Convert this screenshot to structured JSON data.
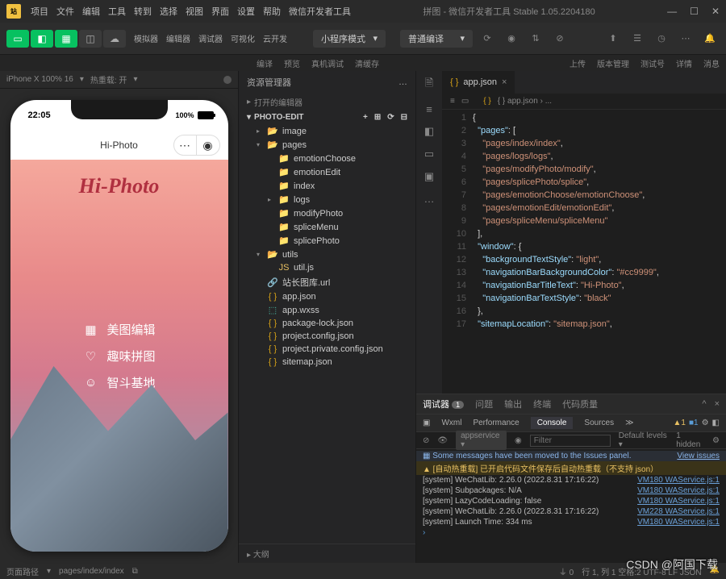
{
  "titlebar": {
    "menus": [
      "项目",
      "文件",
      "编辑",
      "工具",
      "转到",
      "选择",
      "视图",
      "界面",
      "设置",
      "帮助",
      "微信开发者工具"
    ],
    "title": "拼图 - 微信开发者工具 Stable 1.05.2204180"
  },
  "toolbar": {
    "labels1": [
      "模拟器",
      "编辑器",
      "调试器",
      "可视化",
      "云开发"
    ],
    "sel1": "小程序模式",
    "sel2": "普通编译",
    "labels2": [
      "编译",
      "预览",
      "真机调试",
      "清缓存"
    ],
    "labels3": [
      "上传",
      "版本管理",
      "测试号",
      "详情",
      "消息"
    ]
  },
  "siminfo": {
    "device": "iPhone X 100% 16",
    "hot": "热重载: 开"
  },
  "phone": {
    "time": "22:05",
    "battpct": "100%",
    "appname": "Hi-Photo",
    "hero": "Hi-Photo",
    "menu": [
      {
        "icon": "image",
        "label": "美图编辑"
      },
      {
        "icon": "heart",
        "label": "趣味拼图"
      },
      {
        "icon": "smile",
        "label": "智斗基地"
      }
    ]
  },
  "explorer": {
    "title": "资源管理器",
    "openeditors": "打开的编辑器",
    "root": "PHOTO-EDIT",
    "outline": "大纲",
    "tree": [
      {
        "d": 1,
        "t": "folder-g",
        "label": "image",
        "arrow": "▸"
      },
      {
        "d": 1,
        "t": "folder-g",
        "label": "pages",
        "arrow": "▾"
      },
      {
        "d": 2,
        "t": "folder",
        "label": "emotionChoose"
      },
      {
        "d": 2,
        "t": "folder",
        "label": "emotionEdit"
      },
      {
        "d": 2,
        "t": "folder",
        "label": "index"
      },
      {
        "d": 2,
        "t": "folder",
        "label": "logs",
        "arrow": "▸"
      },
      {
        "d": 2,
        "t": "folder",
        "label": "modifyPhoto"
      },
      {
        "d": 2,
        "t": "folder",
        "label": "spliceMenu"
      },
      {
        "d": 2,
        "t": "folder",
        "label": "splicePhoto"
      },
      {
        "d": 1,
        "t": "folder-g",
        "label": "utils",
        "arrow": "▾"
      },
      {
        "d": 2,
        "t": "jsfile",
        "label": "util.js"
      },
      {
        "d": 1,
        "t": "urlfile",
        "label": "站长图库.url"
      },
      {
        "d": 1,
        "t": "jsonfile",
        "label": "app.json"
      },
      {
        "d": 1,
        "t": "wxss",
        "label": "app.wxss"
      },
      {
        "d": 1,
        "t": "jsonfile",
        "label": "package-lock.json"
      },
      {
        "d": 1,
        "t": "jsonfile",
        "label": "project.config.json"
      },
      {
        "d": 1,
        "t": "jsonfile",
        "label": "project.private.config.json"
      },
      {
        "d": 1,
        "t": "jsonfile",
        "label": "sitemap.json"
      }
    ]
  },
  "editor": {
    "tab": "app.json",
    "crumbs": "{ } app.json › ...",
    "lines": [
      {
        "n": 1,
        "t": [
          [
            "pun",
            "{"
          ]
        ]
      },
      {
        "n": 2,
        "t": [
          [
            "pun",
            "  "
          ],
          [
            "key",
            "\"pages\""
          ],
          [
            "pun",
            ": ["
          ]
        ]
      },
      {
        "n": 3,
        "t": [
          [
            "pun",
            "    "
          ],
          [
            "str",
            "\"pages/index/index\""
          ],
          [
            "pun",
            ","
          ]
        ]
      },
      {
        "n": 4,
        "t": [
          [
            "pun",
            "    "
          ],
          [
            "str",
            "\"pages/logs/logs\""
          ],
          [
            "pun",
            ","
          ]
        ]
      },
      {
        "n": 5,
        "t": [
          [
            "pun",
            "    "
          ],
          [
            "str",
            "\"pages/modifyPhoto/modify\""
          ],
          [
            "pun",
            ","
          ]
        ]
      },
      {
        "n": 6,
        "t": [
          [
            "pun",
            "    "
          ],
          [
            "str",
            "\"pages/splicePhoto/splice\""
          ],
          [
            "pun",
            ","
          ]
        ]
      },
      {
        "n": 7,
        "t": [
          [
            "pun",
            "    "
          ],
          [
            "str",
            "\"pages/emotionChoose/emotionChoose\""
          ],
          [
            "pun",
            ","
          ]
        ]
      },
      {
        "n": 8,
        "t": [
          [
            "pun",
            "    "
          ],
          [
            "str",
            "\"pages/emotionEdit/emotionEdit\""
          ],
          [
            "pun",
            ","
          ]
        ]
      },
      {
        "n": 9,
        "t": [
          [
            "pun",
            "    "
          ],
          [
            "str",
            "\"pages/spliceMenu/spliceMenu\""
          ]
        ]
      },
      {
        "n": 10,
        "t": [
          [
            "pun",
            "  ],"
          ]
        ]
      },
      {
        "n": 11,
        "t": [
          [
            "pun",
            "  "
          ],
          [
            "key",
            "\"window\""
          ],
          [
            "pun",
            ": {"
          ]
        ]
      },
      {
        "n": 12,
        "t": [
          [
            "pun",
            "    "
          ],
          [
            "key",
            "\"backgroundTextStyle\""
          ],
          [
            "pun",
            ": "
          ],
          [
            "str",
            "\"light\""
          ],
          [
            "pun",
            ","
          ]
        ]
      },
      {
        "n": 13,
        "t": [
          [
            "pun",
            "    "
          ],
          [
            "key",
            "\"navigationBarBackgroundColor\""
          ],
          [
            "pun",
            ": "
          ],
          [
            "str",
            "\"#cc9999\""
          ],
          [
            "pun",
            ","
          ]
        ]
      },
      {
        "n": 14,
        "t": [
          [
            "pun",
            "    "
          ],
          [
            "key",
            "\"navigationBarTitleText\""
          ],
          [
            "pun",
            ": "
          ],
          [
            "str",
            "\"Hi-Photo\""
          ],
          [
            "pun",
            ","
          ]
        ]
      },
      {
        "n": 15,
        "t": [
          [
            "pun",
            "    "
          ],
          [
            "key",
            "\"navigationBarTextStyle\""
          ],
          [
            "pun",
            ": "
          ],
          [
            "str",
            "\"black\""
          ]
        ]
      },
      {
        "n": 16,
        "t": [
          [
            "pun",
            "  },"
          ]
        ]
      },
      {
        "n": 17,
        "t": [
          [
            "pun",
            "  "
          ],
          [
            "key",
            "\"sitemapLocation\""
          ],
          [
            "pun",
            ": "
          ],
          [
            "str",
            "\"sitemap.json\""
          ],
          [
            "pun",
            ","
          ]
        ]
      }
    ]
  },
  "console": {
    "tabs": [
      "调试器",
      "问题",
      "输出",
      "终端",
      "代码质量"
    ],
    "debugbadge": "1",
    "devtabs": [
      "Wxml",
      "Performance",
      "Console",
      "Sources"
    ],
    "warncount": "1",
    "infocount": "1",
    "context": "appservice",
    "filterph": "Filter",
    "levels": "Default levels",
    "hidden": "1 hidden",
    "issues": "Some messages have been moved to the Issues panel.",
    "viewissues": "View issues",
    "logs": [
      {
        "type": "warn",
        "msg": "▲ [自动热重载] 已开启代码文件保存后自动热重载（不支持 json）"
      },
      {
        "type": "info",
        "msg": "[system] WeChatLib: 2.26.0 (2022.8.31 17:16:22)",
        "src": "VM180 WAService.js:1"
      },
      {
        "type": "info",
        "msg": "[system] Subpackages: N/A",
        "src": "VM180 WAService.js:1"
      },
      {
        "type": "info",
        "msg": "[system] LazyCodeLoading: false",
        "src": "VM180 WAService.js:1"
      },
      {
        "type": "info",
        "msg": "[system] WeChatLib: 2.26.0 (2022.8.31 17:16:22)",
        "src": "VM228 WAService.js:1"
      },
      {
        "type": "info",
        "msg": "[system] Launch Time: 334 ms",
        "src": "VM180 WAService.js:1"
      }
    ]
  },
  "footer": {
    "path": "pages/index/index",
    "route": "页面路径",
    "pos": "行 1, 列 1  空格:2  UTF-8  LF  JSON"
  },
  "watermark": "CSDN @阿国下载"
}
